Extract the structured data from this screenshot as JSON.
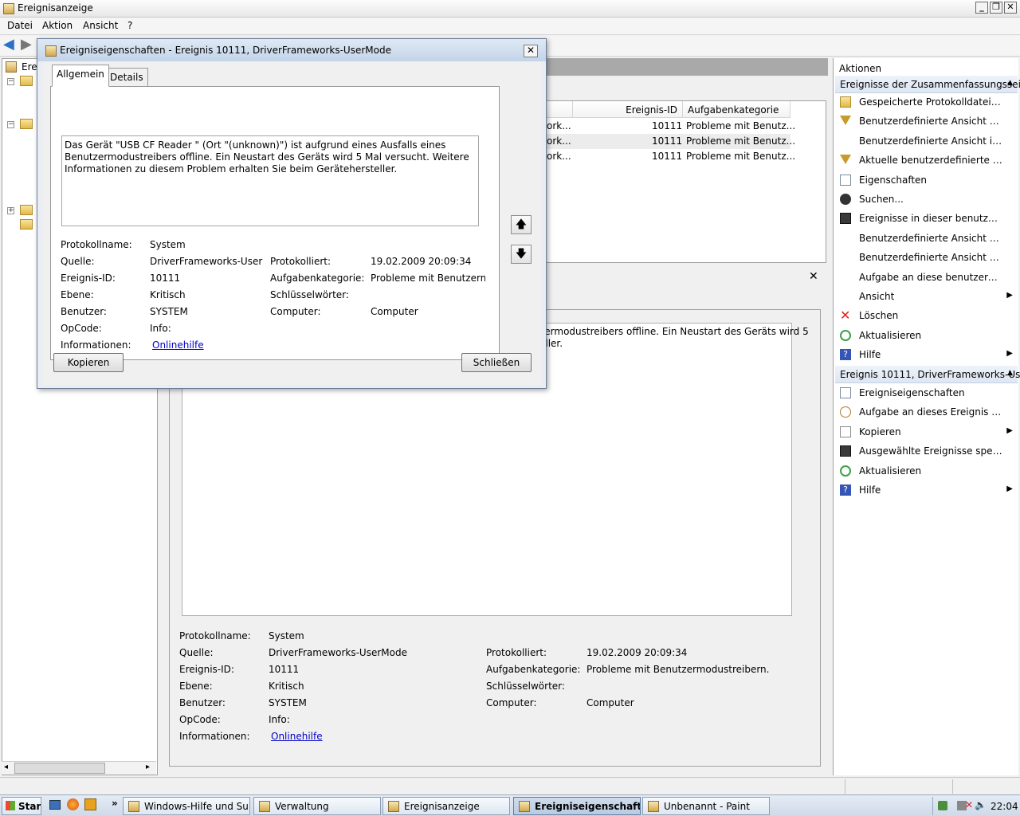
{
  "window": {
    "title": "Ereignisanzeige",
    "menu": [
      "Datei",
      "Aktion",
      "Ansicht",
      "?"
    ]
  },
  "tree": {
    "item_label": "Erei"
  },
  "list": {
    "columns": [
      "Ereignis-ID",
      "Aufgabenkategorie"
    ],
    "rows": [
      {
        "source": "ork...",
        "id": "10111",
        "category": "Probleme mit Benutz..."
      },
      {
        "source": "ork...",
        "id": "10111",
        "category": "Probleme mit Benutz..."
      },
      {
        "source": "ork...",
        "id": "10111",
        "category": "Probleme mit Benutz..."
      }
    ]
  },
  "detail": {
    "text_line1": "zermodustreibers offline. Ein Neustart des Geräts wird 5",
    "text_line2": "eller.",
    "labels": {
      "log": "Protokollname:",
      "source": "Quelle:",
      "event_id": "Ereignis-ID:",
      "level": "Ebene:",
      "user": "Benutzer:",
      "opcode": "OpCode:",
      "info": "Informationen:",
      "logged": "Protokolliert:",
      "task": "Aufgabenkategorie:",
      "keywords": "Schlüsselwörter:",
      "computer": "Computer:"
    },
    "values": {
      "log": "System",
      "source": "DriverFrameworks-UserMode",
      "event_id": "10111",
      "level": "Kritisch",
      "user": "SYSTEM",
      "opcode": "Info:",
      "info": "Onlinehilfe",
      "logged": "19.02.2009 20:09:34",
      "task": "Probleme mit Benutzermodustreibern.",
      "computer": "Computer"
    }
  },
  "actions": {
    "header": "Aktionen",
    "section1": "Ereignisse der Zusammenfassungsseite",
    "items1": [
      {
        "icon": "folder-open-icon",
        "label": "Gespeicherte Protokolldatei öff..."
      },
      {
        "icon": "filter-icon",
        "label": "Benutzerdefinierte Ansicht erste..."
      },
      {
        "icon": "",
        "label": "Benutzerdefinierte Ansicht imp..."
      },
      {
        "icon": "filter-icon",
        "label": "Aktuelle benutzerdefinierte Ansi..."
      },
      {
        "icon": "properties-icon",
        "label": "Eigenschaften"
      },
      {
        "icon": "binoculars-icon",
        "label": "Suchen..."
      },
      {
        "icon": "save-icon",
        "label": "Ereignisse in dieser benutzerdefi..."
      },
      {
        "icon": "",
        "label": "Benutzerdefinierte Ansicht expo..."
      },
      {
        "icon": "",
        "label": "Benutzerdefinierte Ansicht kopi..."
      },
      {
        "icon": "",
        "label": "Aufgabe an diese benutzerdefin..."
      },
      {
        "icon": "",
        "label": "Ansicht",
        "submenu": true
      },
      {
        "icon": "delete-icon",
        "label": "Löschen"
      },
      {
        "icon": "refresh-icon",
        "label": "Aktualisieren"
      },
      {
        "icon": "help-icon",
        "label": "Hilfe",
        "submenu": true
      }
    ],
    "section2": "Ereignis 10111, DriverFrameworks-Us...",
    "items2": [
      {
        "icon": "properties-icon",
        "label": "Ereigniseigenschaften"
      },
      {
        "icon": "task-icon",
        "label": "Aufgabe an dieses Ereignis anfü..."
      },
      {
        "icon": "copy-icon",
        "label": "Kopieren",
        "submenu": true
      },
      {
        "icon": "save-icon",
        "label": "Ausgewählte Ereignisse speiche..."
      },
      {
        "icon": "refresh-icon",
        "label": "Aktualisieren"
      },
      {
        "icon": "help-icon",
        "label": "Hilfe",
        "submenu": true
      }
    ]
  },
  "dialog": {
    "title": "Ereigniseigenschaften - Ereignis 10111, DriverFrameworks-UserMode",
    "tabs": [
      "Allgemein",
      "Details"
    ],
    "message": "Das Gerät \"USB CF Reader   \" (Ort \"(unknown)\") ist aufgrund eines Ausfalls eines Benutzermodustreibers offline. Ein Neustart des Geräts wird 5 Mal versucht. Weitere Informationen zu diesem Problem erhalten Sie beim Gerätehersteller.",
    "values": {
      "log": "System",
      "source": "DriverFrameworks-UserMo",
      "event_id": "10111",
      "level": "Kritisch",
      "user": "SYSTEM",
      "opcode": "Info:",
      "info": "Onlinehilfe",
      "logged": "19.02.2009 20:09:34",
      "task": "Probleme mit Benutzermoc",
      "keywords": "",
      "computer": "Computer"
    },
    "copy_button": "Kopieren",
    "close_button": "Schließen"
  },
  "taskbar": {
    "start": "Start",
    "buttons": [
      {
        "label": "Windows-Hilfe und Su...",
        "active": false
      },
      {
        "label": "Verwaltung",
        "active": false
      },
      {
        "label": "Ereignisanzeige",
        "active": false
      },
      {
        "label": "Ereigniseigenschaften...",
        "active": true
      },
      {
        "label": "Unbenannt - Paint",
        "active": false
      }
    ],
    "clock": "22:04"
  }
}
